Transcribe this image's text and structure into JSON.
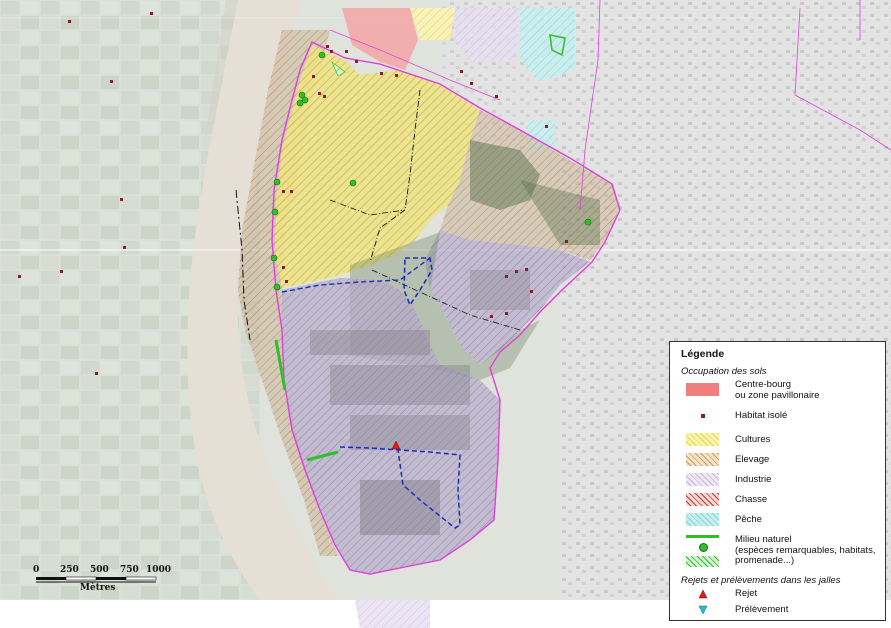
{
  "legend": {
    "title": "Légende",
    "section_land_use": "Occupation des sols",
    "items": [
      {
        "key": "centre",
        "label_l1": "Centre-bourg",
        "label_l2": "ou zone pavillonaire",
        "color": "#f07e7e"
      },
      {
        "key": "habitat",
        "label": "Habitat isolé",
        "color": "#8b1c2c"
      },
      {
        "key": "cultures",
        "label": "Cultures",
        "color": "#e8d83a"
      },
      {
        "key": "elevage",
        "label": "Elevage",
        "color": "#cf9a55"
      },
      {
        "key": "industrie",
        "label": "Industrie",
        "color": "#c6b2dd"
      },
      {
        "key": "chasse",
        "label": "Chasse",
        "color": "#c23a2f"
      },
      {
        "key": "peche",
        "label": "Pêche",
        "color": "#7fd6d6"
      },
      {
        "key": "milieu",
        "label_l1": "Milieu naturel",
        "label_l2": "(espèces remarquables, habitats,",
        "label_l3": "promenade...)",
        "color": "#2fbf2a"
      }
    ],
    "section_discharge": "Rejets et prélèvements dans les jalles",
    "rejet": {
      "label": "Rejet",
      "color": "#e01b1b"
    },
    "prelevement": {
      "label": "Prélèvement",
      "color": "#2ab8d6"
    }
  },
  "scale": {
    "ticks": [
      "0",
      "250",
      "500",
      "750",
      "1000"
    ],
    "unit": "Mètres"
  },
  "colors": {
    "boundary": "#e040d8",
    "dashed_blue": "#1c2fb8",
    "river": "#e5dfd5"
  }
}
